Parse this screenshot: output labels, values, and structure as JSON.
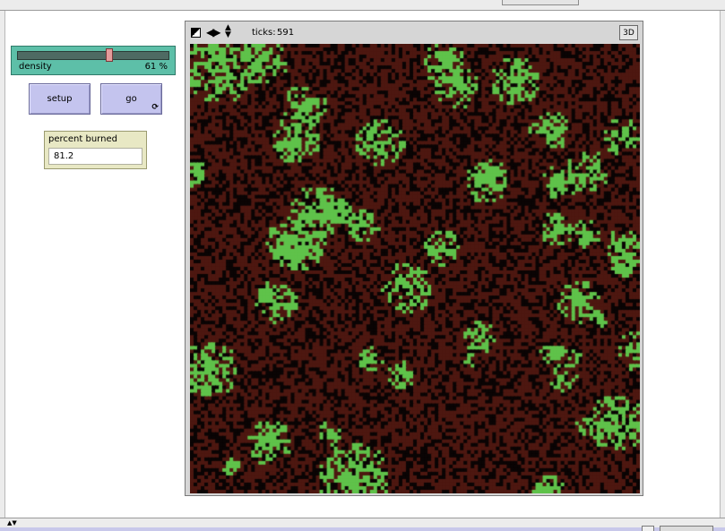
{
  "slider": {
    "name": "density",
    "value": "61",
    "unit": "%",
    "min": 0,
    "max": 100
  },
  "buttons": {
    "setup": "setup",
    "go": "go",
    "forever_icon": "refresh-arrows"
  },
  "monitor": {
    "label": "percent burned",
    "value": "81.2"
  },
  "view": {
    "ticks_label": "ticks:",
    "ticks_value": "591",
    "three_d_label": "3D",
    "patch_colors": {
      "burned": "#4d1710",
      "ash": "#0a0404",
      "tree": "#5fc24a"
    }
  },
  "icons": {
    "view_controls": [
      "half-icon",
      "arrows-lr-icon",
      "arrows-ud-icon"
    ]
  }
}
